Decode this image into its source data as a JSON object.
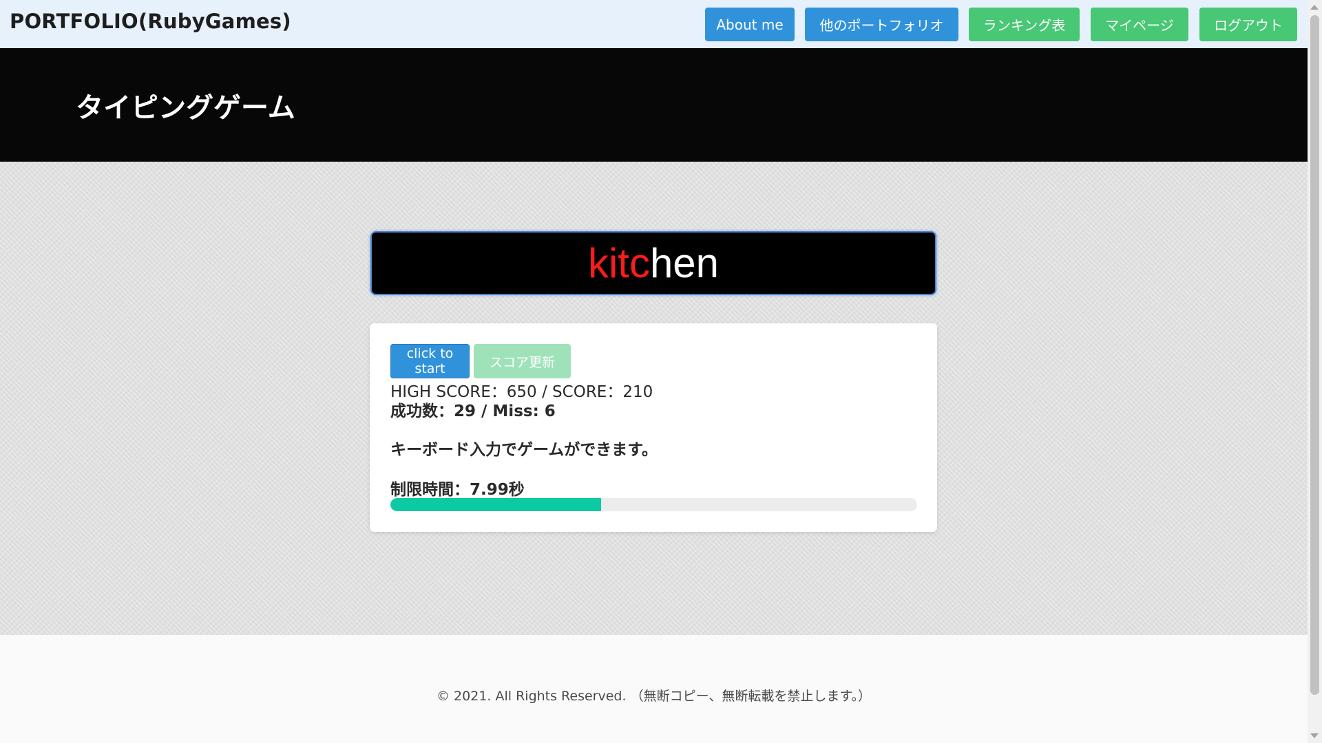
{
  "navbar": {
    "brand": "PORTFOLIO(RubyGames)",
    "buttons": [
      {
        "label": "About me",
        "color": "#3092db"
      },
      {
        "label": "他のポートフォリオ",
        "color": "#3092db"
      },
      {
        "label": "ランキング表",
        "color": "#48c774"
      },
      {
        "label": "マイページ",
        "color": "#48c774"
      },
      {
        "label": "ログアウト",
        "color": "#48c774"
      }
    ]
  },
  "hero": {
    "title": "タイピングゲーム"
  },
  "word": {
    "typed": "kitc",
    "remaining": "hen"
  },
  "card": {
    "start_label": "click to start",
    "score_update_label": "スコア更新",
    "score_line": "HIGH SCORE：650 / SCORE：210",
    "counts_line": "成功数：29 / Miss: 6",
    "instruction": "キーボード入力でゲームができます。",
    "time_limit": "制限時間：7.99秒",
    "progress_fraction": 0.4
  },
  "footer": {
    "text": "© 2021. All Rights Reserved. （無断コピー、無断転載を禁止します。）"
  },
  "colors": {
    "primary": "#3092db",
    "success": "#48c774",
    "progress": "#0ccaa4",
    "typed": "#ff1b1b"
  }
}
